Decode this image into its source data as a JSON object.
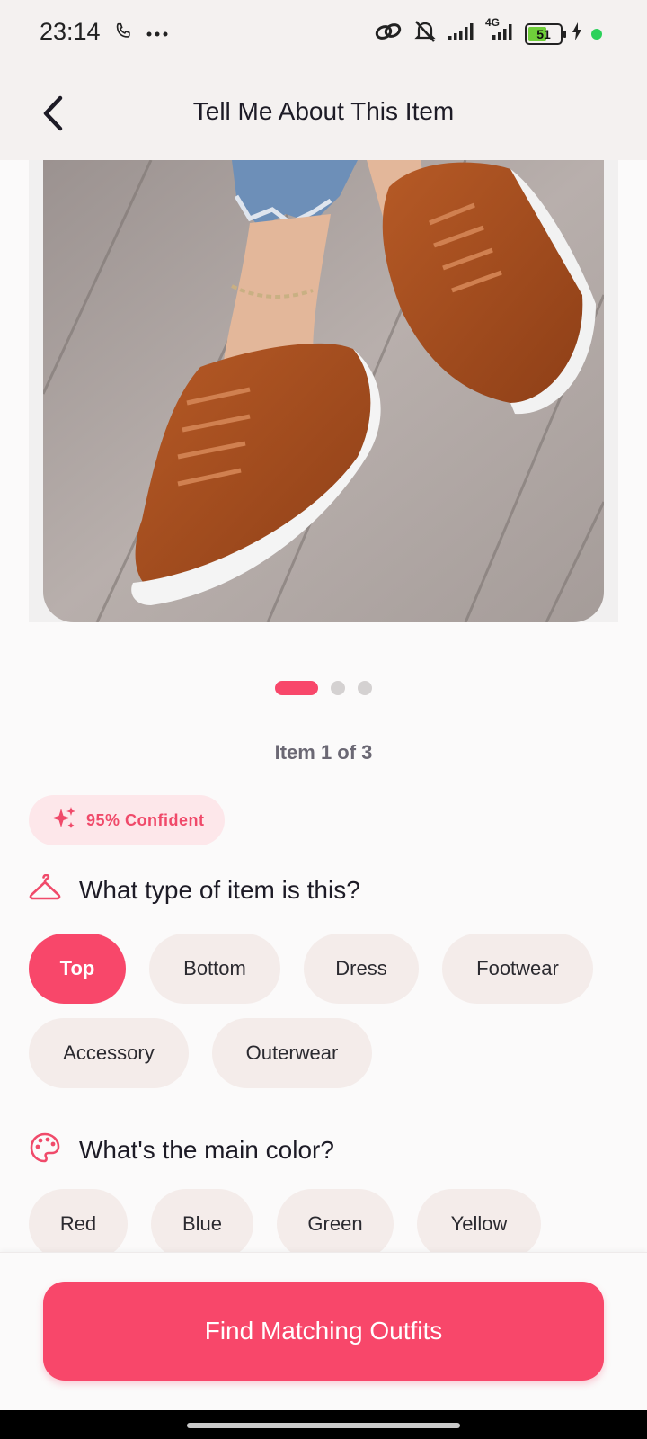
{
  "status_bar": {
    "time": "23:14",
    "battery_level": "51",
    "network": "4G",
    "icons": [
      "phone-icon",
      "more-dots-icon",
      "link-icon",
      "mute-icon",
      "signal-icon",
      "battery-icon",
      "charging-icon"
    ]
  },
  "app_bar": {
    "title": "Tell Me About This Item",
    "back_icon": "chevron-left-icon"
  },
  "gallery": {
    "image_alt": "brown suede sneakers",
    "current_page": 1,
    "total_pages": 3,
    "counter_text": "Item 1 of 3"
  },
  "confidence": {
    "text": "95% Confident",
    "icon": "sparkles-icon"
  },
  "type_section": {
    "title": "What type of item is this?",
    "icon": "hanger-icon",
    "options": [
      "Top",
      "Bottom",
      "Dress",
      "Footwear",
      "Accessory",
      "Outerwear"
    ],
    "selected": "Top"
  },
  "color_section": {
    "title": "What's the main color?",
    "icon": "palette-icon",
    "options": [
      "Red",
      "Blue",
      "Green",
      "Yellow"
    ]
  },
  "cta": {
    "label": "Find Matching Outfits"
  },
  "colors": {
    "accent": "#f8476a",
    "chip_background": "#f4ecea",
    "badge_background": "#fde7ea"
  }
}
